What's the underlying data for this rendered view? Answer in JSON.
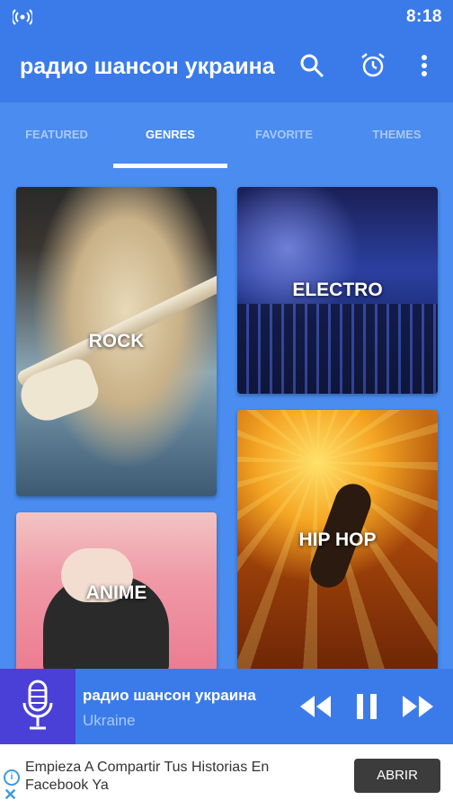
{
  "status_bar": {
    "time": "8:18",
    "signal_icon": "hotspot-icon"
  },
  "app_bar": {
    "title": "радио шансон украина",
    "icons": [
      "search-icon",
      "alarm-icon",
      "more-vert-icon"
    ]
  },
  "tabs": [
    {
      "label": "FEATURED",
      "active": false
    },
    {
      "label": "GENRES",
      "active": true
    },
    {
      "label": "FAVORITE",
      "active": false
    },
    {
      "label": "THEMES",
      "active": false
    }
  ],
  "genres": [
    {
      "label": "ROCK"
    },
    {
      "label": "ELECTRO"
    },
    {
      "label": "HIP HOP"
    },
    {
      "label": "ANIME"
    }
  ],
  "player": {
    "station": "радио шансон украина",
    "country": "Ukraine",
    "art_icon": "microphone-icon",
    "controls": [
      "rewind-icon",
      "pause-icon",
      "fast-forward-icon"
    ]
  },
  "ad": {
    "text": "Empieza A Compartir Tus Historias En Facebook Ya",
    "button": "ABRIR",
    "info_icon": "i",
    "close_icon": "✕"
  },
  "colors": {
    "primary": "#3b7be9",
    "tabs_bg": "#4a8cef",
    "inactive_tab": "#a9c8f7"
  }
}
